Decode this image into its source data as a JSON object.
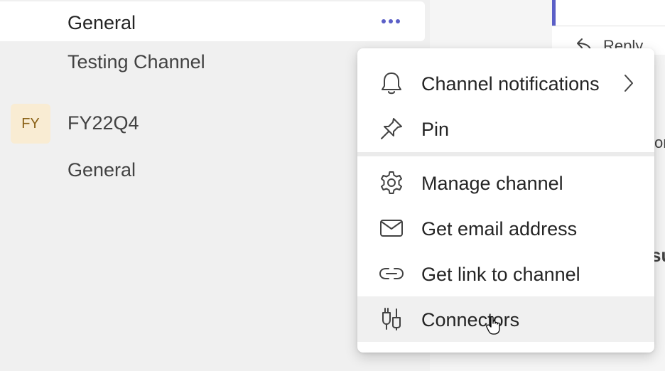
{
  "sidebar": {
    "team1_channels": [
      {
        "label": "General",
        "selected": true
      },
      {
        "label": "Testing Channel",
        "selected": false
      }
    ],
    "team2": {
      "avatar_text": "FY",
      "name": "FY22Q4",
      "channels": [
        {
          "label": "General"
        }
      ]
    },
    "more_icon": "more-options-icon"
  },
  "content": {
    "reply_label": "Reply",
    "peek_text_1": "or",
    "peek_text_2": "su"
  },
  "menu": {
    "items": [
      {
        "label": "Channel notifications",
        "icon": "bell-icon",
        "has_submenu": true
      },
      {
        "label": "Pin",
        "icon": "pin-icon"
      },
      {
        "label": "Manage channel",
        "icon": "gear-icon"
      },
      {
        "label": "Get email address",
        "icon": "mail-icon"
      },
      {
        "label": "Get link to channel",
        "icon": "link-icon"
      },
      {
        "label": "Connectors",
        "icon": "connectors-icon",
        "hovered": true
      }
    ]
  },
  "colors": {
    "accent": "#5b5fc7",
    "avatar_bg": "#f9ecd3",
    "avatar_text": "#8a6116",
    "sidebar_bg": "#f0f0f0"
  }
}
